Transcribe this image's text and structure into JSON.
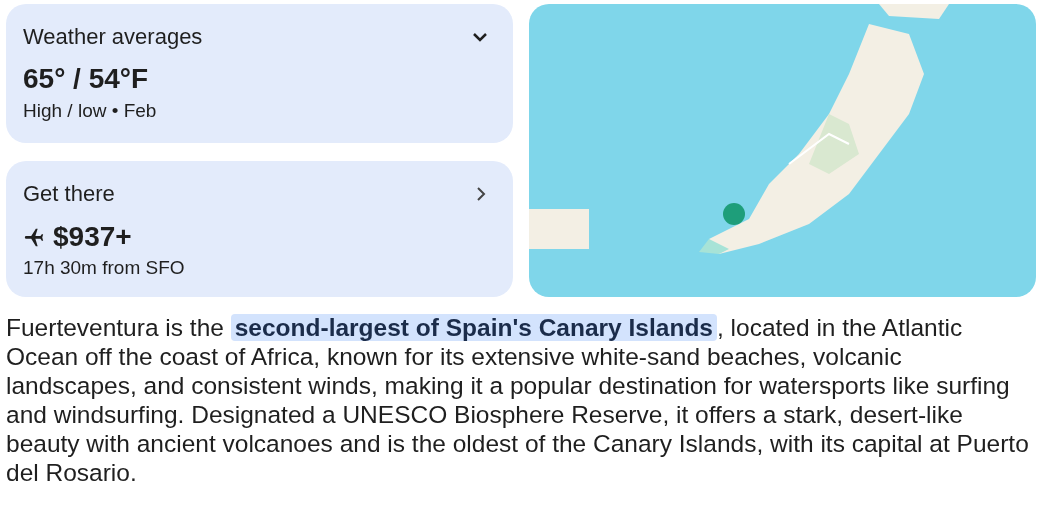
{
  "weather_card": {
    "title": "Weather averages",
    "expanded": false,
    "temperature": "65° / 54°F",
    "caption": "High / low • Feb"
  },
  "travel_card": {
    "title": "Get there",
    "price": "$937+",
    "caption": "17h 30m from SFO"
  },
  "description": {
    "before": "Fuerteventura is the ",
    "highlight": "second-largest of Spain's Canary Islands",
    "after": ", located in the Atlantic Ocean off the coast of Africa, known for its extensive white-sand beaches, volcanic landscapes, and consistent winds, making it a popular destination for watersports like surfing and windsurfing. Designated a UNESCO Biosphere Reserve, it offers a stark, desert-like beauty with ancient volcanoes and is the oldest of the Canary Islands, with its capital at Puerto del Rosario."
  }
}
